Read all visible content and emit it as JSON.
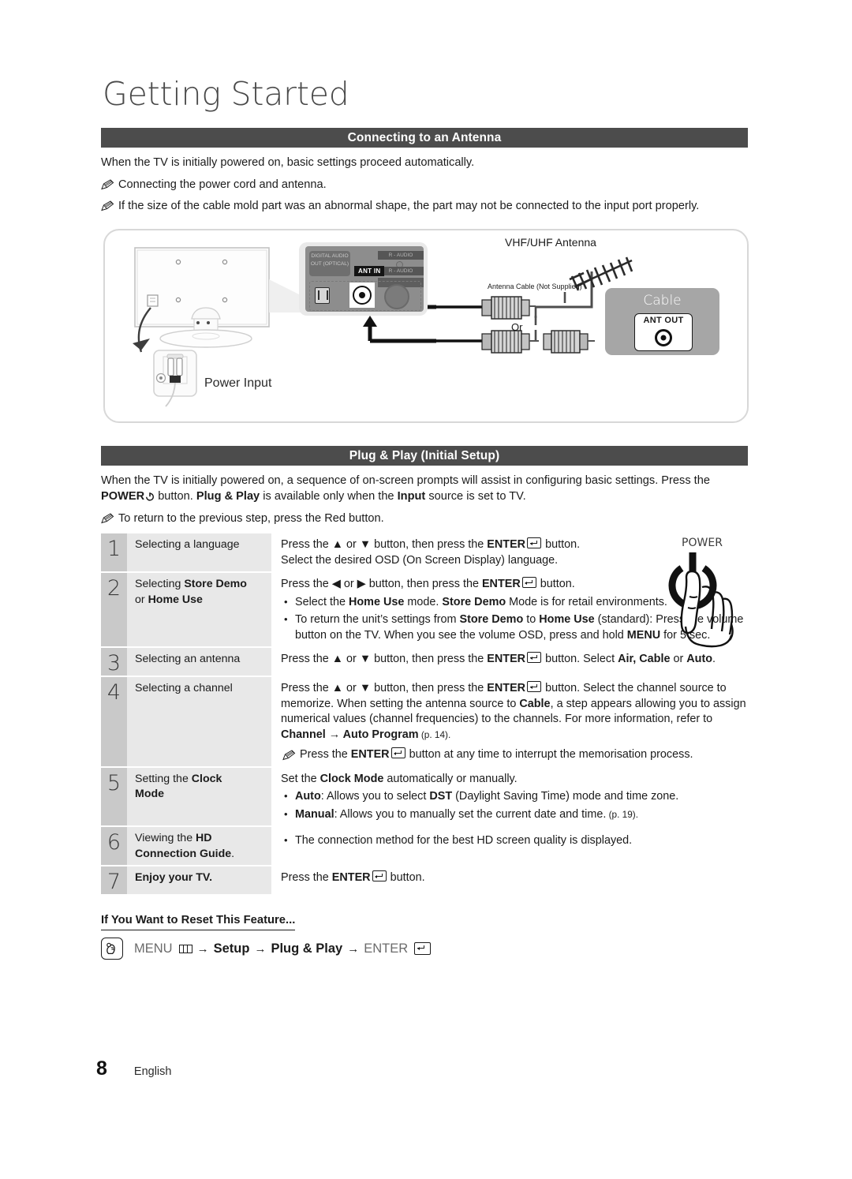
{
  "page": {
    "chapter_title": "Getting Started",
    "footer_page_number": "8",
    "footer_language": "English"
  },
  "antenna_section": {
    "header": "Connecting to an Antenna",
    "intro": "When the TV is initially powered on, basic settings proceed automatically.",
    "notes": [
      "Connecting the power cord and antenna.",
      "If the size of the cable mold part was an abnormal shape, the part may not be connected to the input port properly."
    ],
    "diagram": {
      "power_input_label": "Power Input",
      "vhf_uhf_label": "VHF/UHF Antenna",
      "antenna_cable_label": "Antenna Cable (Not Supplied)",
      "or_label": "Or",
      "cable_box_title": "Cable",
      "cable_box_jack_label": "ANT OUT",
      "tv_panel": {
        "digital_audio_out": "DIGITAL AUDIO OUT (OPTICAL)",
        "ant_in": "ANT IN",
        "r_audio_top": "R - AUDIO",
        "r_audio_bottom": "R - AUDIO"
      }
    }
  },
  "plug_play_section": {
    "header": "Plug & Play (Initial Setup)",
    "intro_part1": "When the TV is initially powered on, a sequence of on-screen prompts will assist in configuring basic settings. Press the ",
    "intro_power": "POWER",
    "intro_part2": " button. ",
    "intro_plugplay": "Plug & Play",
    "intro_part3": " is available only when the ",
    "intro_input": "Input",
    "intro_part4": " source is set to TV.",
    "note": "To return to the previous step, press the Red button.",
    "power_illustration_label": "POWER",
    "steps": [
      {
        "number": "1",
        "label_plain": "Selecting a language",
        "desc_line1_a": "Press the ",
        "desc_line1_up": "▲",
        "desc_line1_b": " or ",
        "desc_line1_down": "▼",
        "desc_line1_c": " button, then press the ",
        "desc_line1_enter": "ENTER",
        "desc_line1_d": " button.",
        "desc_line2": "Select the desired OSD (On Screen Display) language."
      },
      {
        "number": "2",
        "label_a": "Selecting ",
        "label_b": "Store Demo",
        "label_c": "or ",
        "label_d": "Home Use",
        "desc_head_a": "Press the ",
        "desc_head_left": "◀",
        "desc_head_b": " or ",
        "desc_head_right": "▶",
        "desc_head_c": " button, then press the ",
        "desc_head_enter": "ENTER",
        "desc_head_d": " button.",
        "bullet1": {
          "a": "Select the ",
          "b": "Home Use",
          "c": " mode. ",
          "d": "Store Demo",
          "e": " Mode is for retail environments."
        },
        "bullet2": {
          "a": "To return the unit’s settings from ",
          "b": "Store Demo",
          "c": " to ",
          "d": "Home Use",
          "e": " (standard): Press the volume button on the TV. When you see the volume OSD, press and hold ",
          "f": "MENU",
          "g": " for 5 sec."
        }
      },
      {
        "number": "3",
        "label_plain": "Selecting an antenna",
        "desc_a": "Press the ",
        "desc_up": "▲",
        "desc_b": " or ",
        "desc_down": "▼",
        "desc_c": " button, then press the ",
        "desc_enter": "ENTER",
        "desc_d": " button. Select ",
        "desc_opt1": "Air, Cable",
        "desc_e": " or ",
        "desc_opt2": "Auto",
        "desc_f": "."
      },
      {
        "number": "4",
        "label_plain": "Selecting a channel",
        "desc_a": "Press the ",
        "desc_up": "▲",
        "desc_b": " or ",
        "desc_down": "▼",
        "desc_c": " button, then press the ",
        "desc_enter": "ENTER",
        "desc_d": " button. Select the channel source to memorize. When setting the antenna source to ",
        "desc_cable": "Cable",
        "desc_e": ", a step appears allowing you to assign numerical values (channel frequencies) to the channels. For more information, refer to ",
        "desc_channel": "Channel",
        "desc_arrow": " → ",
        "desc_autoprog": "Auto Program",
        "desc_page": " (p. 14).",
        "subnote_a": "Press the ",
        "subnote_enter": "ENTER",
        "subnote_b": " button at any time to interrupt the memorisation process."
      },
      {
        "number": "5",
        "label_a": "Setting the ",
        "label_b": "Clock",
        "label_c": "Mode",
        "desc_head_a": "Set the ",
        "desc_head_b": "Clock Mode",
        "desc_head_c": " automatically or manually.",
        "bullet1": {
          "a": "Auto",
          "b": ": Allows you to select ",
          "c": "DST",
          "d": " (Daylight Saving Time) mode and time zone."
        },
        "bullet2": {
          "a": "Manual",
          "b": ": Allows you to manually set the current date and time.",
          "c": " (p. 19)."
        }
      },
      {
        "number": "6",
        "label_a": "Viewing the ",
        "label_b": "HD",
        "label_c": "Connection Guide",
        "label_d": ".",
        "bullet1": "The connection method for the best HD screen quality is displayed."
      },
      {
        "number": "7",
        "label_bold": "Enjoy your TV.",
        "desc_a": "Press the ",
        "desc_enter": "ENTER",
        "desc_b": " button."
      }
    ]
  },
  "reset_feature": {
    "title": "If You Want to Reset This Feature...",
    "path_menu": "MENU",
    "path_arrow1": "→",
    "path_setup": "Setup",
    "path_arrow2": "→",
    "path_plugplay": "Plug & Play",
    "path_arrow3": "→",
    "path_enter": "ENTER"
  },
  "colors": {
    "section_bar": "#4c4c4c",
    "step_number_bg": "#c9c9c9",
    "step_label_bg": "#e8e8e8",
    "cable_panel": "#a6a6a6",
    "text": "#1b1b1b"
  }
}
